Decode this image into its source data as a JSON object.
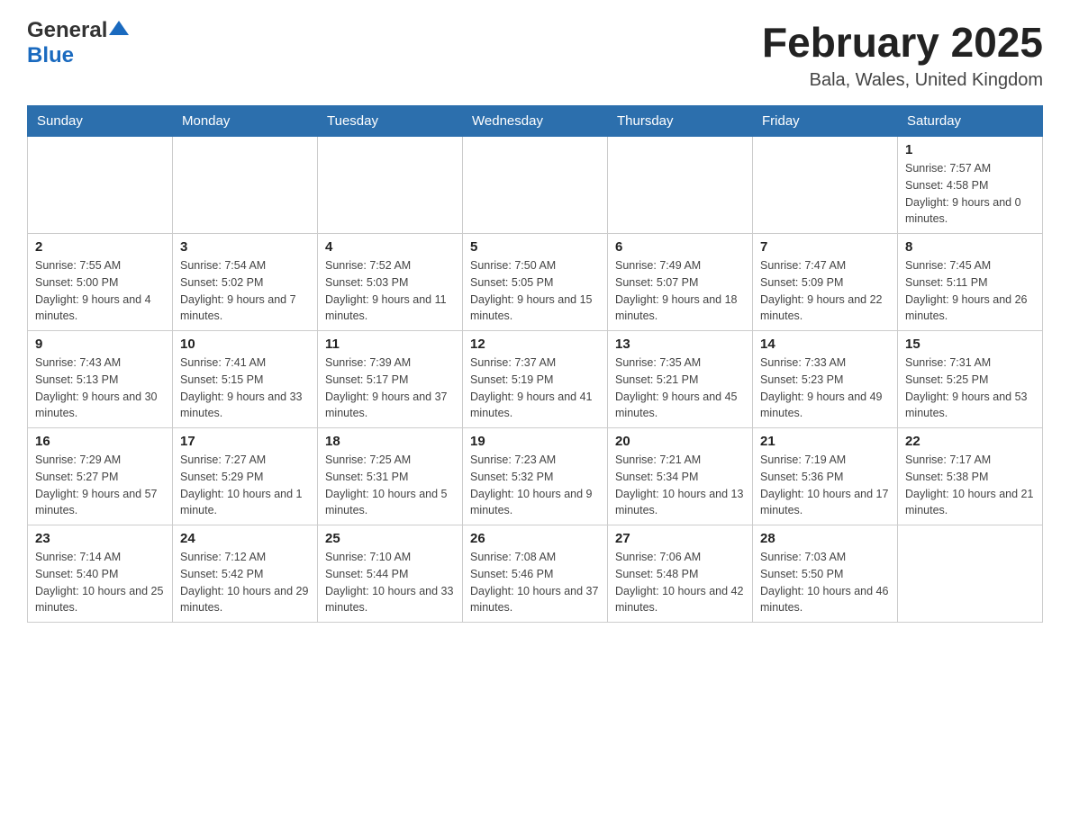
{
  "header": {
    "logo_general": "General",
    "logo_blue": "Blue",
    "month_title": "February 2025",
    "location": "Bala, Wales, United Kingdom"
  },
  "weekdays": [
    "Sunday",
    "Monday",
    "Tuesday",
    "Wednesday",
    "Thursday",
    "Friday",
    "Saturday"
  ],
  "weeks": [
    [
      {
        "day": "",
        "info": ""
      },
      {
        "day": "",
        "info": ""
      },
      {
        "day": "",
        "info": ""
      },
      {
        "day": "",
        "info": ""
      },
      {
        "day": "",
        "info": ""
      },
      {
        "day": "",
        "info": ""
      },
      {
        "day": "1",
        "info": "Sunrise: 7:57 AM\nSunset: 4:58 PM\nDaylight: 9 hours and 0 minutes."
      }
    ],
    [
      {
        "day": "2",
        "info": "Sunrise: 7:55 AM\nSunset: 5:00 PM\nDaylight: 9 hours and 4 minutes."
      },
      {
        "day": "3",
        "info": "Sunrise: 7:54 AM\nSunset: 5:02 PM\nDaylight: 9 hours and 7 minutes."
      },
      {
        "day": "4",
        "info": "Sunrise: 7:52 AM\nSunset: 5:03 PM\nDaylight: 9 hours and 11 minutes."
      },
      {
        "day": "5",
        "info": "Sunrise: 7:50 AM\nSunset: 5:05 PM\nDaylight: 9 hours and 15 minutes."
      },
      {
        "day": "6",
        "info": "Sunrise: 7:49 AM\nSunset: 5:07 PM\nDaylight: 9 hours and 18 minutes."
      },
      {
        "day": "7",
        "info": "Sunrise: 7:47 AM\nSunset: 5:09 PM\nDaylight: 9 hours and 22 minutes."
      },
      {
        "day": "8",
        "info": "Sunrise: 7:45 AM\nSunset: 5:11 PM\nDaylight: 9 hours and 26 minutes."
      }
    ],
    [
      {
        "day": "9",
        "info": "Sunrise: 7:43 AM\nSunset: 5:13 PM\nDaylight: 9 hours and 30 minutes."
      },
      {
        "day": "10",
        "info": "Sunrise: 7:41 AM\nSunset: 5:15 PM\nDaylight: 9 hours and 33 minutes."
      },
      {
        "day": "11",
        "info": "Sunrise: 7:39 AM\nSunset: 5:17 PM\nDaylight: 9 hours and 37 minutes."
      },
      {
        "day": "12",
        "info": "Sunrise: 7:37 AM\nSunset: 5:19 PM\nDaylight: 9 hours and 41 minutes."
      },
      {
        "day": "13",
        "info": "Sunrise: 7:35 AM\nSunset: 5:21 PM\nDaylight: 9 hours and 45 minutes."
      },
      {
        "day": "14",
        "info": "Sunrise: 7:33 AM\nSunset: 5:23 PM\nDaylight: 9 hours and 49 minutes."
      },
      {
        "day": "15",
        "info": "Sunrise: 7:31 AM\nSunset: 5:25 PM\nDaylight: 9 hours and 53 minutes."
      }
    ],
    [
      {
        "day": "16",
        "info": "Sunrise: 7:29 AM\nSunset: 5:27 PM\nDaylight: 9 hours and 57 minutes."
      },
      {
        "day": "17",
        "info": "Sunrise: 7:27 AM\nSunset: 5:29 PM\nDaylight: 10 hours and 1 minute."
      },
      {
        "day": "18",
        "info": "Sunrise: 7:25 AM\nSunset: 5:31 PM\nDaylight: 10 hours and 5 minutes."
      },
      {
        "day": "19",
        "info": "Sunrise: 7:23 AM\nSunset: 5:32 PM\nDaylight: 10 hours and 9 minutes."
      },
      {
        "day": "20",
        "info": "Sunrise: 7:21 AM\nSunset: 5:34 PM\nDaylight: 10 hours and 13 minutes."
      },
      {
        "day": "21",
        "info": "Sunrise: 7:19 AM\nSunset: 5:36 PM\nDaylight: 10 hours and 17 minutes."
      },
      {
        "day": "22",
        "info": "Sunrise: 7:17 AM\nSunset: 5:38 PM\nDaylight: 10 hours and 21 minutes."
      }
    ],
    [
      {
        "day": "23",
        "info": "Sunrise: 7:14 AM\nSunset: 5:40 PM\nDaylight: 10 hours and 25 minutes."
      },
      {
        "day": "24",
        "info": "Sunrise: 7:12 AM\nSunset: 5:42 PM\nDaylight: 10 hours and 29 minutes."
      },
      {
        "day": "25",
        "info": "Sunrise: 7:10 AM\nSunset: 5:44 PM\nDaylight: 10 hours and 33 minutes."
      },
      {
        "day": "26",
        "info": "Sunrise: 7:08 AM\nSunset: 5:46 PM\nDaylight: 10 hours and 37 minutes."
      },
      {
        "day": "27",
        "info": "Sunrise: 7:06 AM\nSunset: 5:48 PM\nDaylight: 10 hours and 42 minutes."
      },
      {
        "day": "28",
        "info": "Sunrise: 7:03 AM\nSunset: 5:50 PM\nDaylight: 10 hours and 46 minutes."
      },
      {
        "day": "",
        "info": ""
      }
    ]
  ]
}
